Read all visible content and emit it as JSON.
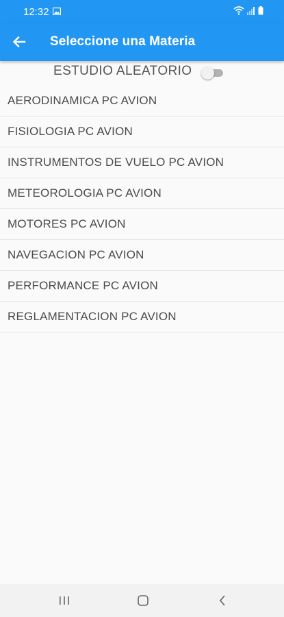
{
  "status_bar": {
    "time": "12:32",
    "icons": [
      "image-icon",
      "wifi-icon",
      "signal-icon",
      "battery-icon"
    ]
  },
  "app_bar": {
    "back_icon": "arrow-left-icon",
    "title": "Seleccione una Materia",
    "color": "#2196f3"
  },
  "random_study": {
    "label": "ESTUDIO ALEATORIO",
    "enabled": false
  },
  "subjects": [
    {
      "label": "AERODINAMICA PC AVION"
    },
    {
      "label": "FISIOLOGIA PC AVION"
    },
    {
      "label": "INSTRUMENTOS DE VUELO PC AVION"
    },
    {
      "label": "METEOROLOGIA PC AVION"
    },
    {
      "label": "MOTORES PC AVION"
    },
    {
      "label": "NAVEGACION PC AVION"
    },
    {
      "label": "PERFORMANCE PC AVION"
    },
    {
      "label": "REGLAMENTACION PC AVION"
    }
  ],
  "nav_bar": {
    "icons": [
      "recent-apps-icon",
      "home-icon",
      "back-icon"
    ]
  }
}
